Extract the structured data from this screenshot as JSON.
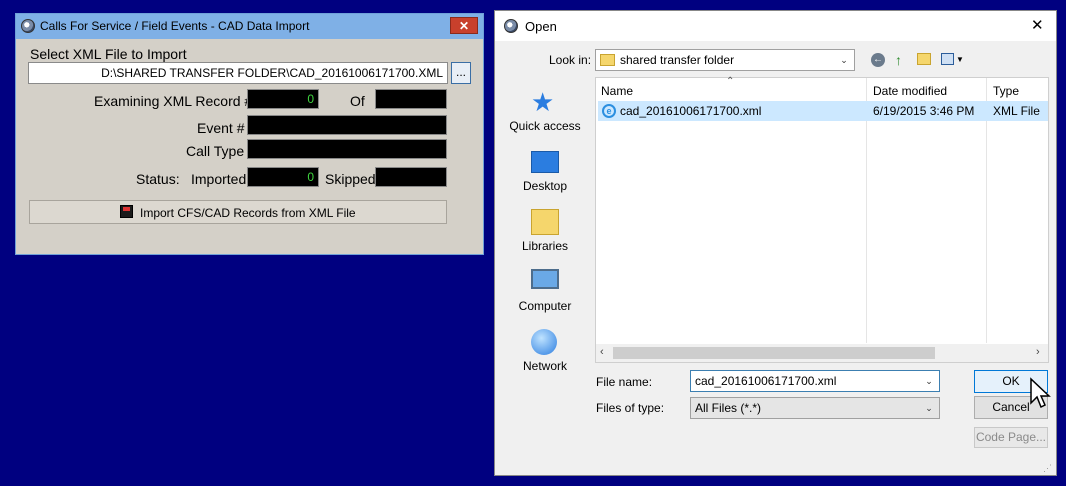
{
  "import_window": {
    "title": "Calls For Service / Field Events - CAD Data Import",
    "select_label": "Select XML File to Import",
    "file_path": "D:\\SHARED TRANSFER FOLDER\\CAD_20161006171700.XML",
    "browse_label": "...",
    "examining_label": "Examining XML Record #",
    "examining_value": "0",
    "of_label": "Of",
    "of_value": "",
    "event_label": "Event #",
    "event_value": "",
    "calltype_label": "Call Type",
    "calltype_value": "",
    "status_label": "Status:",
    "imported_label": "Imported",
    "imported_value": "0",
    "skipped_label": "Skipped",
    "skipped_value": "",
    "import_button": "Import CFS/CAD Records from XML File",
    "close_glyph": "✕"
  },
  "open_dialog": {
    "title": "Open",
    "close_glyph": "✕",
    "look_in_label": "Look in:",
    "look_in_value": "shared transfer folder",
    "places": [
      {
        "label": "Quick access",
        "icon": "star-icon"
      },
      {
        "label": "Desktop",
        "icon": "desktop-icon"
      },
      {
        "label": "Libraries",
        "icon": "libraries-icon"
      },
      {
        "label": "Computer",
        "icon": "computer-icon"
      },
      {
        "label": "Network",
        "icon": "network-icon"
      }
    ],
    "columns": {
      "name": "Name",
      "date": "Date modified",
      "type": "Type"
    },
    "files": [
      {
        "name": "cad_20161006171700.xml",
        "date": "6/19/2015 3:46 PM",
        "type": "XML File"
      }
    ],
    "file_name_label": "File name:",
    "file_name_value": "cad_20161006171700.xml",
    "file_type_label": "Files of type:",
    "file_type_value": "All Files (*.*)",
    "ok_button": "OK",
    "cancel_button": "Cancel",
    "code_page_button": "Code Page...",
    "colors": {
      "accent": "#000080",
      "selection": "#cce8ff",
      "titlebar": "#7fb0e6"
    }
  }
}
